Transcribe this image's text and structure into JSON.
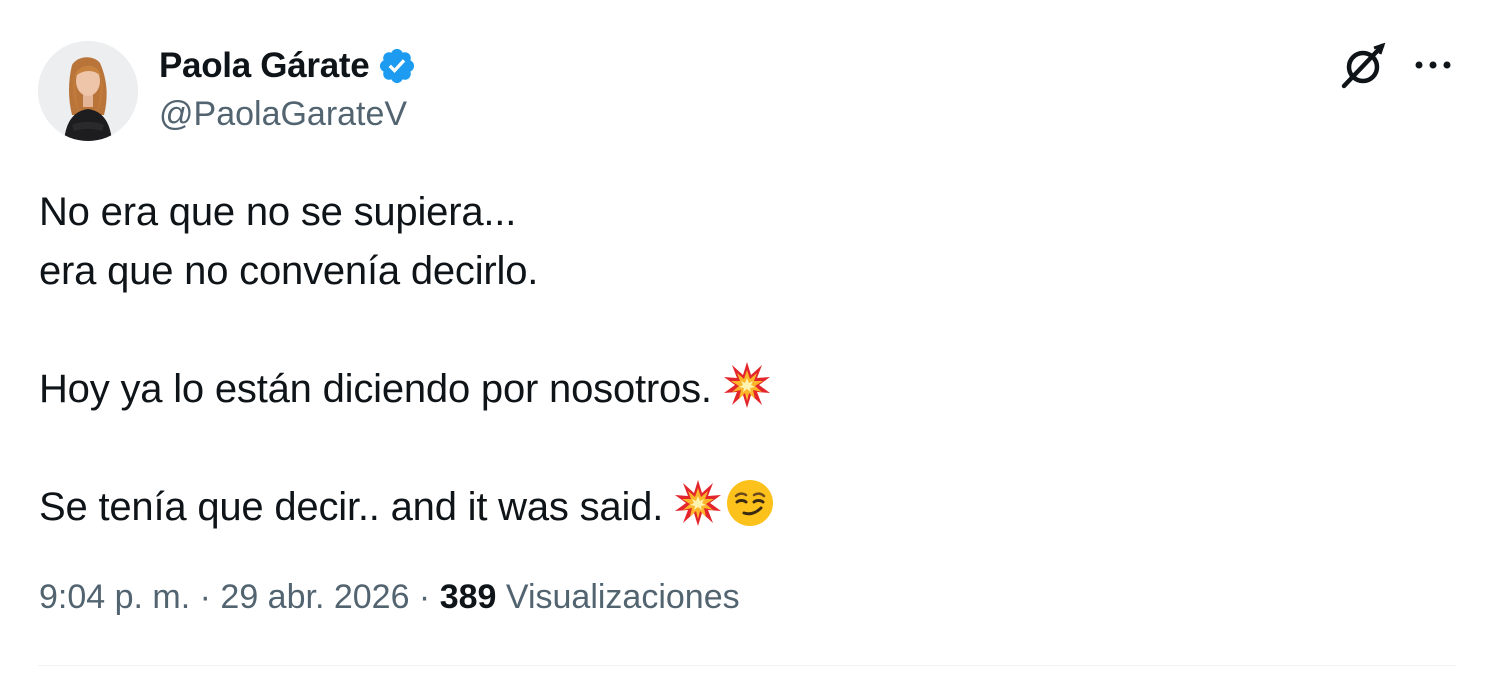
{
  "author": {
    "display_name": "Paola Gárate",
    "handle": "@PaolaGarateV",
    "verified": true,
    "verified_color": "#1d9bf0"
  },
  "tweet": {
    "lines": [
      "No era que no se supiera...",
      "era que no convenía decirlo.",
      "",
      "Hoy ya lo están diciendo por nosotros.",
      "",
      "Se tenía que decir.. and it was said."
    ],
    "emojis": {
      "line4": [
        "collision-emoji"
      ],
      "line6": [
        "collision-emoji",
        "smirking-face-emoji"
      ]
    }
  },
  "meta": {
    "time": "9:04 p. m.",
    "separator1": " · ",
    "date": "29 abr. 2026",
    "separator2": " · ",
    "views_count": "389",
    "views_label": " Visualizaciones"
  },
  "icons": {
    "grok": "grok-icon",
    "more": "more-options-icon",
    "verified": "verified-badge-icon"
  },
  "colors": {
    "text_primary": "#0f1419",
    "text_secondary": "#536471",
    "divider": "#eff3f4"
  }
}
